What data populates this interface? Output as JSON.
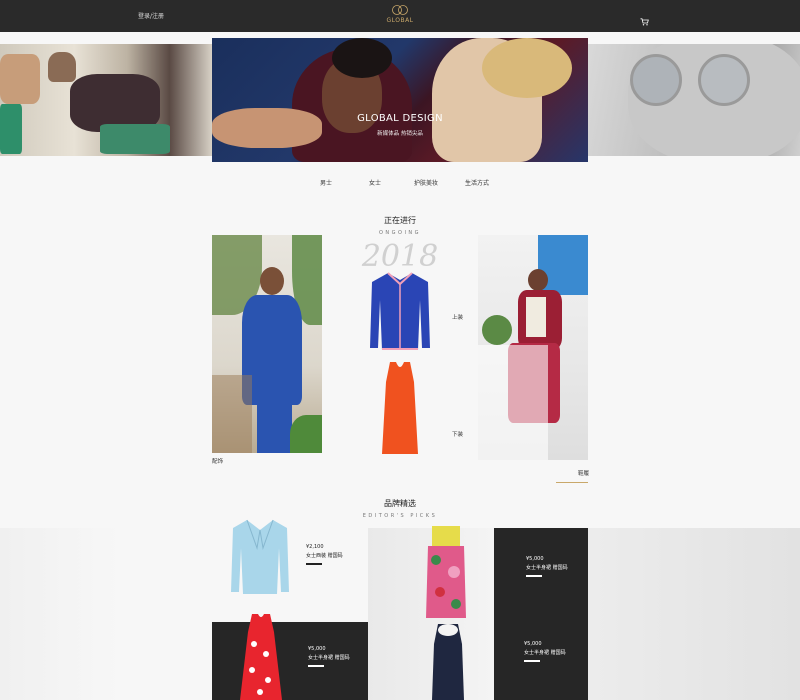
{
  "topbar": {
    "login_label": "登录/注册",
    "logo_text": "GLOBAL",
    "cart_icon": "cart-icon"
  },
  "hero": {
    "title": "GLOBAL DESIGN",
    "subtitle": "新媒体品 热销尖品"
  },
  "category_nav": {
    "items": [
      "男士",
      "女士",
      "护肤美妆",
      "生活方式"
    ]
  },
  "ongoing": {
    "title": "正在进行",
    "subtitle": "ONGOING",
    "year": "2018",
    "label_left": "配饰",
    "label_top": "上装",
    "label_bottom": "下装",
    "label_more": "鞋履"
  },
  "picks": {
    "title": "品牌精选",
    "subtitle": "EDITOR'S PICKS",
    "items": [
      {
        "price": "¥2,100",
        "desc": "女士西装 赠国码"
      },
      {
        "price": "¥5,000",
        "desc": "女士半身裙 赠国码"
      },
      {
        "price": "¥5,000",
        "desc": "女士半身裙 赠国码"
      },
      {
        "price": "¥5,000",
        "desc": "女士半身裙 赠国码"
      }
    ]
  },
  "colors": {
    "topbar": "#2a2a2a",
    "accent_gold": "#c9a86a",
    "dark_panel": "#262626"
  }
}
